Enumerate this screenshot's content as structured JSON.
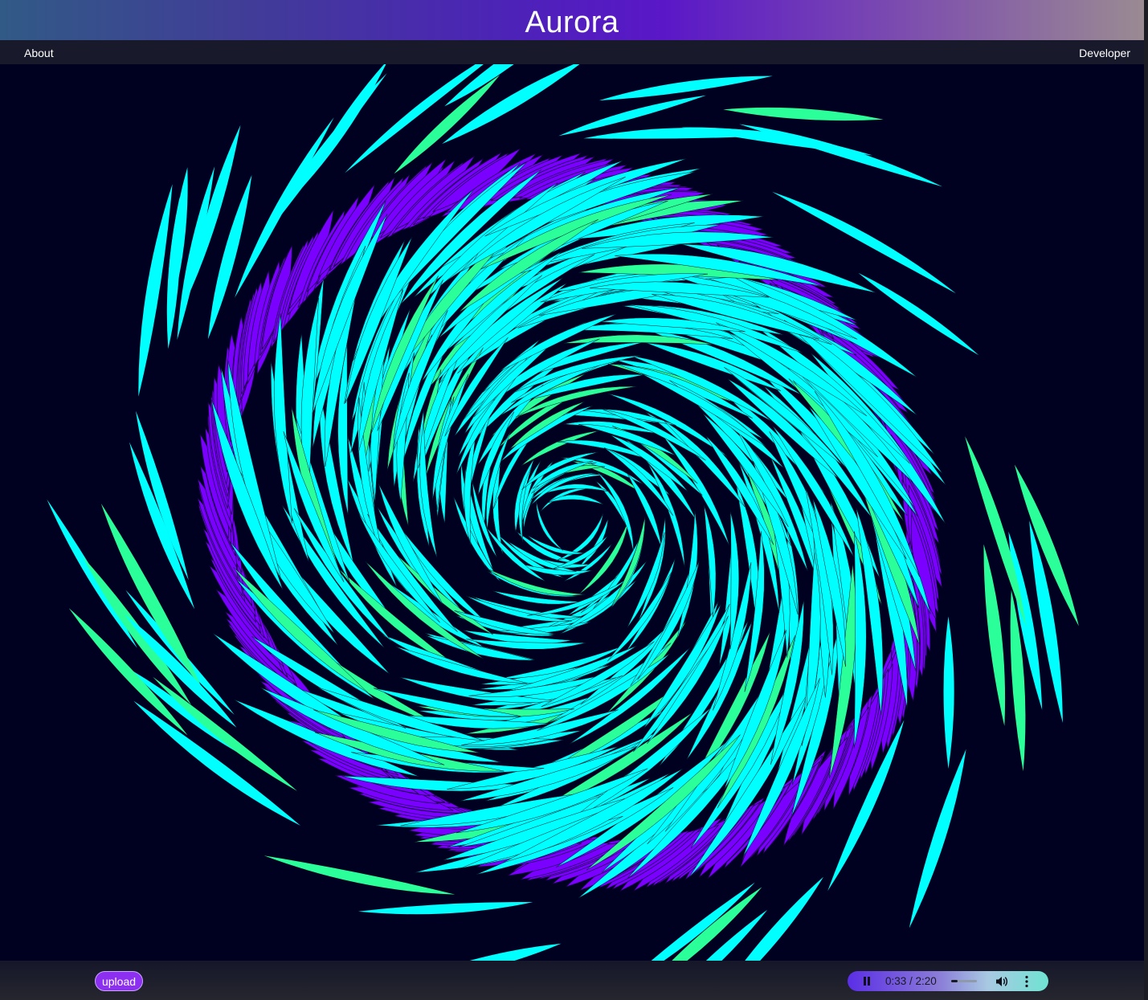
{
  "app": {
    "title": "Aurora"
  },
  "nav": {
    "about_label": "About",
    "developer_label": "Developer"
  },
  "visualizer": {
    "colors": {
      "background": "#000021",
      "ring": "#7a00ff",
      "ring_stroke": "#1a0040",
      "streak": "#00ffff",
      "streak_accent": "#2bff9a",
      "streak_stroke": "#001a2a"
    }
  },
  "footer": {
    "upload_label": "upload"
  },
  "player": {
    "state": "playing",
    "time": "0:33 / 2:20",
    "progress": 0.2357,
    "pause_icon": "pause-icon",
    "volume_icon": "volume-icon",
    "more_icon": "more-options-icon",
    "gradient_start": "#5b2ee6",
    "gradient_end": "#6fe3d2"
  }
}
